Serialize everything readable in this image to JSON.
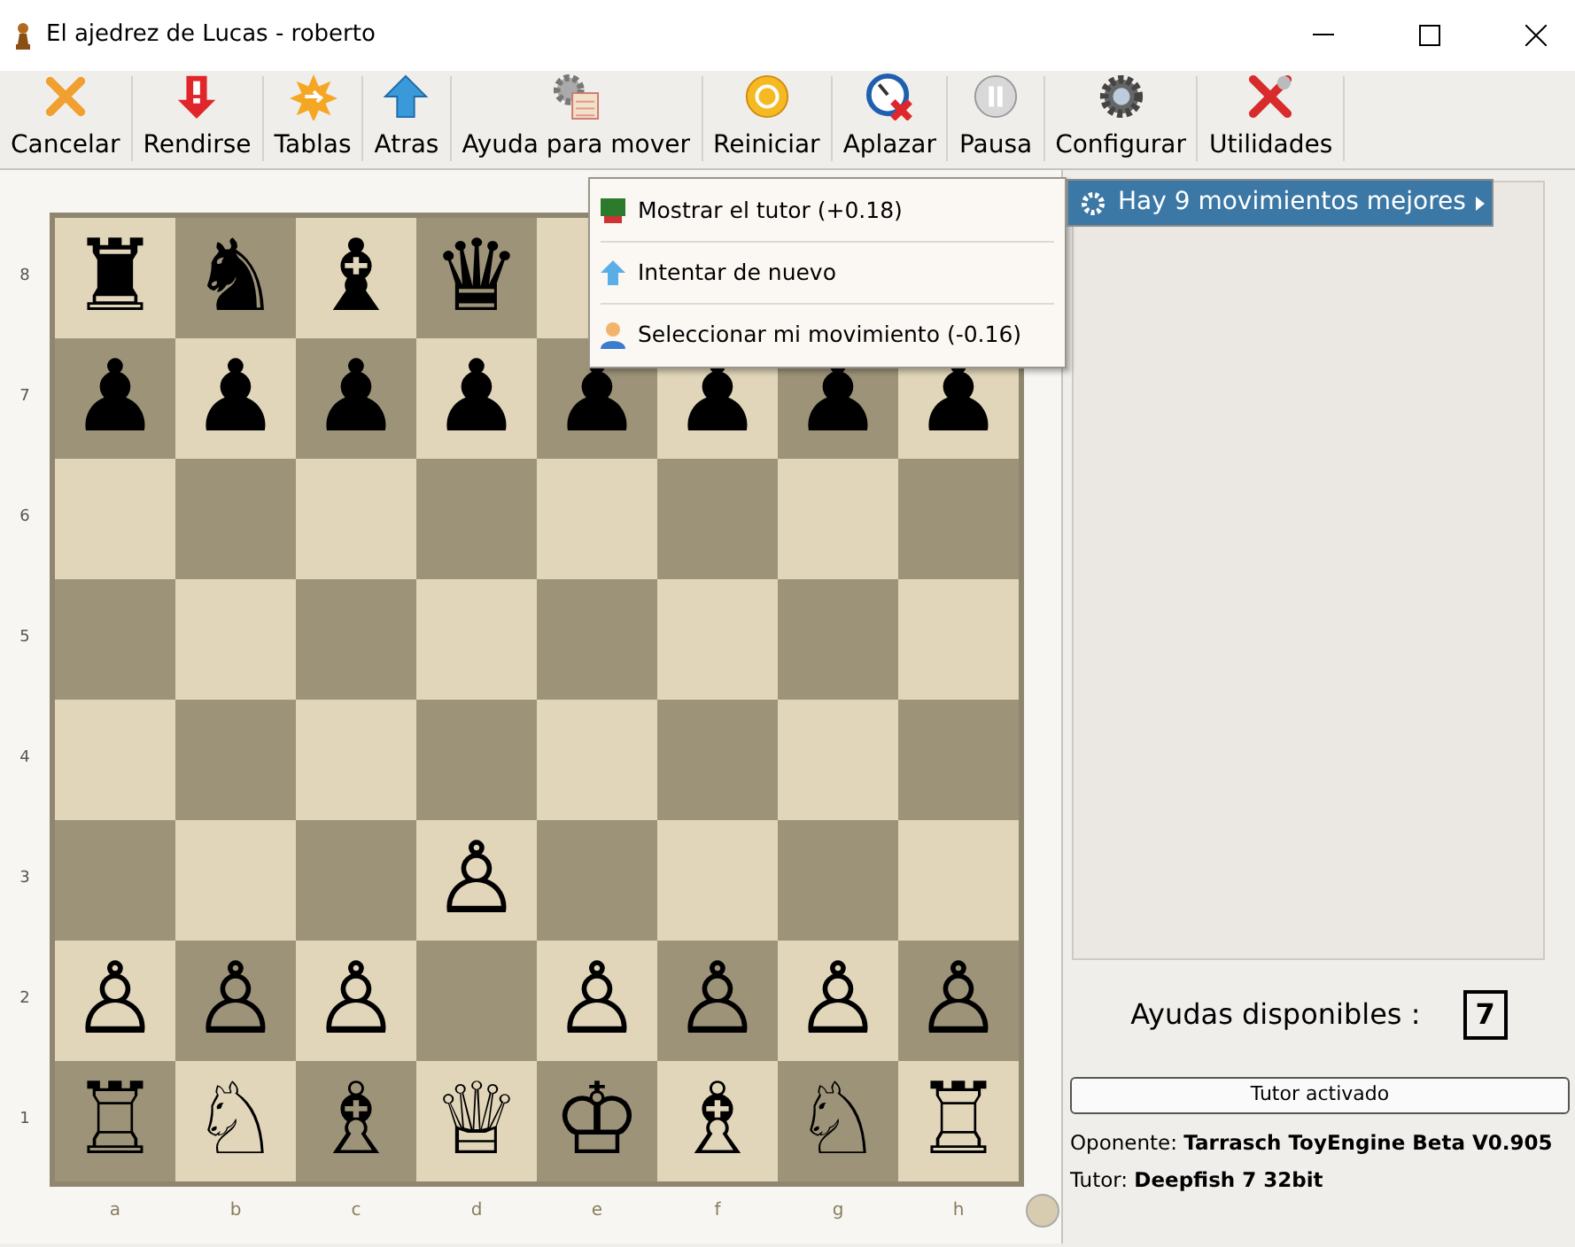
{
  "window": {
    "title": "El ajedrez de Lucas - roberto"
  },
  "toolbar": [
    {
      "label": "Cancelar",
      "kind": "cancel"
    },
    {
      "label": "Rendirse",
      "kind": "resign"
    },
    {
      "label": "Tablas",
      "kind": "draw"
    },
    {
      "label": "Atras",
      "kind": "back"
    },
    {
      "label": "Ayuda para mover",
      "kind": "help"
    },
    {
      "label": "Reiniciar",
      "kind": "restart"
    },
    {
      "label": "Aplazar",
      "kind": "postpone"
    },
    {
      "label": "Pausa",
      "kind": "pause"
    },
    {
      "label": "Configurar",
      "kind": "config"
    },
    {
      "label": "Utilidades",
      "kind": "tools"
    }
  ],
  "board": {
    "ranks": [
      {
        "label": "8",
        "squares": [
          {
            "kind": "piece",
            "glyph": "♜"
          },
          {
            "kind": "piece",
            "glyph": "♞"
          },
          {
            "kind": "piece",
            "glyph": "♝"
          },
          {
            "kind": "piece",
            "glyph": "♛"
          },
          {
            "kind": "empty"
          }
        ]
      },
      {
        "label": "7",
        "squares": [
          {
            "kind": "piece",
            "glyph": "♟"
          },
          {
            "kind": "piece",
            "glyph": "♟"
          },
          {
            "kind": "piece",
            "glyph": "♟"
          },
          {
            "kind": "piece",
            "glyph": "♟"
          },
          {
            "kind": "piece",
            "glyph": "♟"
          },
          {
            "kind": "piece",
            "glyph": "♟"
          },
          {
            "kind": "piece",
            "glyph": "♟"
          },
          {
            "kind": "piece",
            "glyph": "♟"
          }
        ]
      },
      {
        "label": "6",
        "squares": [
          {
            "kind": "empty"
          },
          {
            "kind": "empty"
          },
          {
            "kind": "empty"
          },
          {
            "kind": "empty"
          },
          {
            "kind": "empty"
          },
          {
            "kind": "empty"
          },
          {
            "kind": "empty"
          },
          {
            "kind": "empty"
          }
        ]
      },
      {
        "label": "5",
        "squares": [
          {
            "kind": "empty"
          },
          {
            "kind": "empty"
          },
          {
            "kind": "empty"
          },
          {
            "kind": "empty"
          },
          {
            "kind": "empty"
          },
          {
            "kind": "empty"
          },
          {
            "kind": "empty"
          },
          {
            "kind": "empty"
          }
        ]
      },
      {
        "label": "4",
        "squares": [
          {
            "kind": "empty"
          },
          {
            "kind": "empty"
          },
          {
            "kind": "empty"
          },
          {
            "kind": "empty"
          },
          {
            "kind": "empty"
          },
          {
            "kind": "empty"
          },
          {
            "kind": "empty"
          },
          {
            "kind": "empty"
          }
        ]
      },
      {
        "label": "3",
        "squares": [
          {
            "kind": "empty"
          },
          {
            "kind": "empty"
          },
          {
            "kind": "empty"
          },
          {
            "kind": "piece",
            "glyph": "♙"
          },
          {
            "kind": "empty"
          },
          {
            "kind": "empty"
          },
          {
            "kind": "empty"
          },
          {
            "kind": "empty"
          }
        ]
      },
      {
        "label": "2",
        "squares": [
          {
            "kind": "piece",
            "glyph": "♙"
          },
          {
            "kind": "piece",
            "glyph": "♙"
          },
          {
            "kind": "piece",
            "glyph": "♙"
          },
          {
            "kind": "empty"
          },
          {
            "kind": "piece",
            "glyph": "♙"
          },
          {
            "kind": "piece",
            "glyph": "♙"
          },
          {
            "kind": "piece",
            "glyph": "♙"
          },
          {
            "kind": "piece",
            "glyph": "♙"
          }
        ]
      },
      {
        "label": "1",
        "squares": [
          {
            "kind": "piece",
            "glyph": "♖"
          },
          {
            "kind": "piece",
            "glyph": "♘"
          },
          {
            "kind": "piece",
            "glyph": "♗"
          },
          {
            "kind": "piece",
            "glyph": "♕"
          },
          {
            "kind": "piece",
            "glyph": "♔"
          },
          {
            "kind": "piece",
            "glyph": "♗"
          },
          {
            "kind": "piece",
            "glyph": "♘"
          },
          {
            "kind": "piece",
            "glyph": "♖"
          }
        ]
      }
    ],
    "files": [
      "a",
      "b",
      "c",
      "d",
      "e",
      "f",
      "g",
      "h"
    ]
  },
  "context_menu": {
    "items": [
      {
        "label": "Mostrar el tutor (+0.18)",
        "kind": "tutor"
      },
      {
        "label": "Intentar de nuevo",
        "kind": "retry"
      },
      {
        "label": "Seleccionar mi movimiento (-0.16)",
        "kind": "mine"
      }
    ]
  },
  "submenu": {
    "label": "Hay 9 movimientos mejores",
    "selected": true
  },
  "panel": {
    "hints_label": "Ayudas disponibles :",
    "hints_count": "7",
    "tutor_button": "Tutor activado",
    "opponent": {
      "label": "Oponente:",
      "name": "Tarrasch ToyEngine Beta V0.905"
    },
    "tutor": {
      "label": "Tutor:",
      "name": "Deepfish 7 32bit"
    }
  }
}
